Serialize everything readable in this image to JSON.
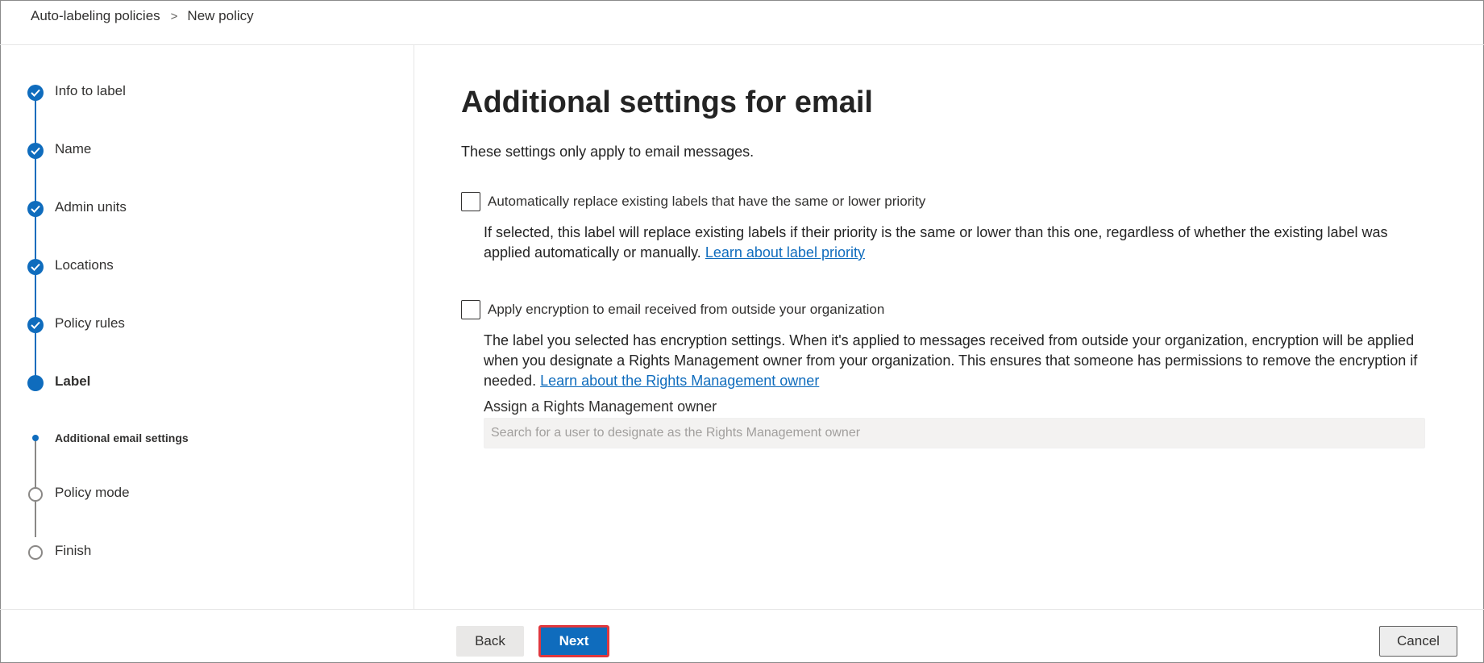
{
  "breadcrumb": {
    "parent": "Auto-labeling policies",
    "separator": ">",
    "current": "New policy"
  },
  "wizard": {
    "steps": [
      {
        "label": "Info to label",
        "state": "complete"
      },
      {
        "label": "Name",
        "state": "complete"
      },
      {
        "label": "Admin units",
        "state": "complete"
      },
      {
        "label": "Locations",
        "state": "complete"
      },
      {
        "label": "Policy rules",
        "state": "complete"
      },
      {
        "label": "Label",
        "state": "current"
      },
      {
        "label": "Additional email settings",
        "state": "current-substep"
      },
      {
        "label": "Policy mode",
        "state": "not-started"
      },
      {
        "label": "Finish",
        "state": "not-started"
      }
    ]
  },
  "main": {
    "title": "Additional settings for email",
    "description": "These settings only apply to email messages.",
    "option_replace": {
      "label": "Automatically replace existing labels that have the same or lower priority",
      "checked": false,
      "help_text": "If selected, this label will replace existing labels if their priority is the same or lower than this one, regardless of whether the existing label was applied automatically or manually.",
      "link": "Learn about label priority"
    },
    "option_encrypt": {
      "label": "Apply encryption to email received from outside your organization",
      "checked": false,
      "help_text": "The label you selected has encryption settings. When it's applied to messages received from outside your organization, encryption will be applied when you designate a Rights Management owner from your organization. This ensures that someone has permissions to remove the encryption if needed.",
      "link": "Learn about the Rights Management owner"
    },
    "owner": {
      "label": "Assign a Rights Management owner",
      "value": "",
      "placeholder": "Search for a user to designate as the Rights Management owner"
    }
  },
  "footer": {
    "back_label": "Back",
    "next_label": "Next",
    "cancel_label": "Cancel"
  },
  "colors": {
    "accent": "#0f6cbd",
    "highlight_border": "#e0383e",
    "pending_step": "#8a8886"
  },
  "icons": {
    "completed_step": "checkmark-circle-icon",
    "current_step": "filled-circle-icon",
    "pending_step": "empty-circle-icon",
    "breadcrumb_separator": "chevron-right-icon"
  }
}
